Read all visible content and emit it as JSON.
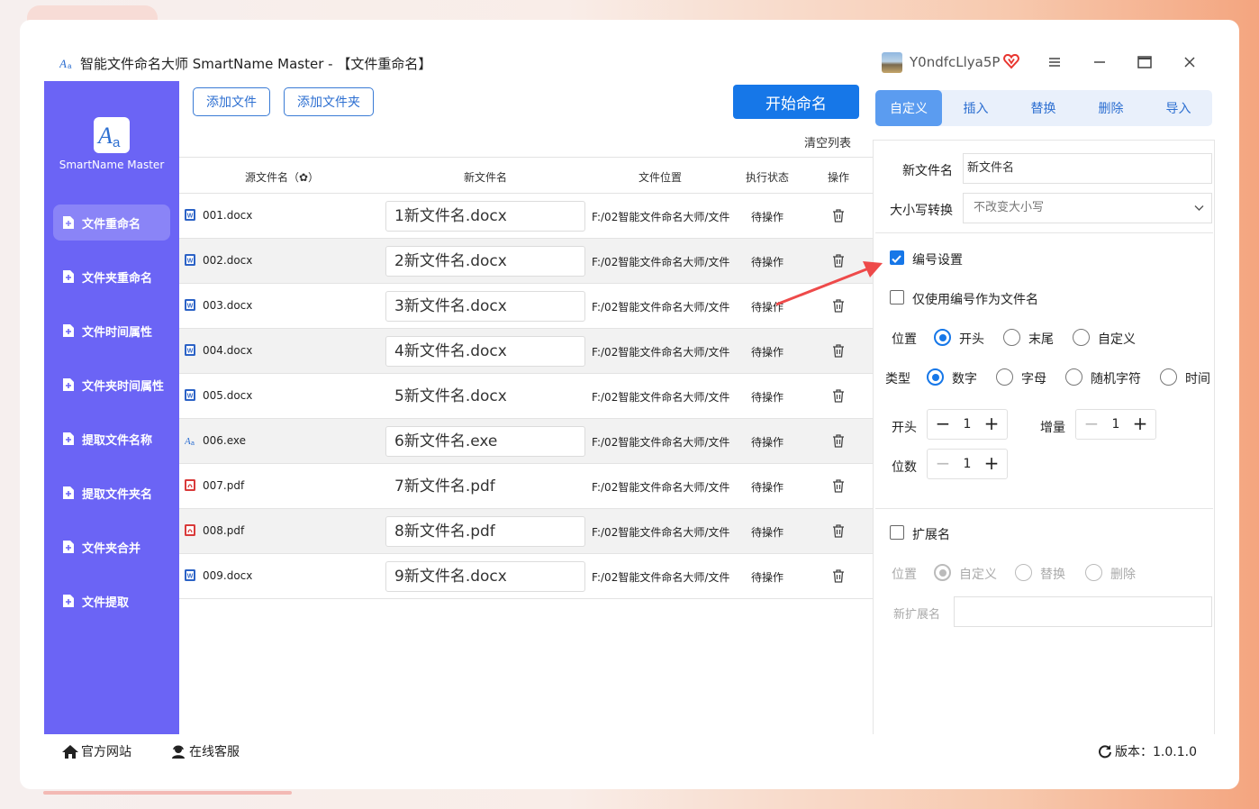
{
  "window": {
    "title": "智能文件命名大师 SmartName Master - 【文件重命名】",
    "username": "Y0ndfcLlya5P"
  },
  "sidebar": {
    "logo_text": "SmartName Master",
    "items": [
      {
        "label": "文件重命名",
        "active": true
      },
      {
        "label": "文件夹重命名",
        "active": false
      },
      {
        "label": "文件时间属性",
        "active": false
      },
      {
        "label": "文件夹时间属性",
        "active": false
      },
      {
        "label": "提取文件名称",
        "active": false
      },
      {
        "label": "提取文件夹名",
        "active": false
      },
      {
        "label": "文件夹合并",
        "active": false
      },
      {
        "label": "文件提取",
        "active": false
      }
    ]
  },
  "toolbar": {
    "add_file": "添加文件",
    "add_folder": "添加文件夹",
    "start": "开始命名",
    "clear": "清空列表"
  },
  "table": {
    "headers": {
      "source": "源文件名（✿）",
      "newname": "新文件名",
      "location": "文件位置",
      "status": "执行状态",
      "action": "操作"
    },
    "rows": [
      {
        "icon": "word-icon",
        "src": "001.docx",
        "new": "1新文件名.docx",
        "loc": "F:/02智能文件命名大师/文件",
        "status": "待操作"
      },
      {
        "icon": "word-icon",
        "src": "002.docx",
        "new": "2新文件名.docx",
        "loc": "F:/02智能文件命名大师/文件",
        "status": "待操作"
      },
      {
        "icon": "word-icon",
        "src": "003.docx",
        "new": "3新文件名.docx",
        "loc": "F:/02智能文件命名大师/文件",
        "status": "待操作"
      },
      {
        "icon": "word-icon",
        "src": "004.docx",
        "new": "4新文件名.docx",
        "loc": "F:/02智能文件命名大师/文件",
        "status": "待操作"
      },
      {
        "icon": "word-icon",
        "src": "005.docx",
        "new": "5新文件名.docx",
        "loc": "F:/02智能文件命名大师/文件",
        "status": "待操作"
      },
      {
        "icon": "app-icon",
        "src": "006.exe",
        "new": "6新文件名.exe",
        "loc": "F:/02智能文件命名大师/文件",
        "status": "待操作"
      },
      {
        "icon": "pdf-icon",
        "src": "007.pdf",
        "new": "7新文件名.pdf",
        "loc": "F:/02智能文件命名大师/文件",
        "status": "待操作"
      },
      {
        "icon": "pdf-icon",
        "src": "008.pdf",
        "new": "8新文件名.pdf",
        "loc": "F:/02智能文件命名大师/文件",
        "status": "待操作"
      },
      {
        "icon": "word-icon",
        "src": "009.docx",
        "new": "9新文件名.docx",
        "loc": "F:/02智能文件命名大师/文件",
        "status": "待操作"
      }
    ]
  },
  "right_panel": {
    "tabs": [
      "自定义",
      "插入",
      "替换",
      "删除",
      "导入"
    ],
    "active_tab": "自定义",
    "new_name_label": "新文件名",
    "new_name_value": "新文件名",
    "case_label": "大小写转换",
    "case_value": "不改变大小写",
    "numbering_label": "编号设置",
    "numbering_checked": true,
    "only_number_label": "仅使用编号作为文件名",
    "only_number_checked": false,
    "position_label": "位置",
    "position_options": [
      "开头",
      "末尾",
      "自定义"
    ],
    "position_selected": "开头",
    "type_label": "类型",
    "type_options": [
      "数字",
      "字母",
      "随机字符",
      "时间"
    ],
    "type_selected": "数字",
    "start_label": "开头",
    "start_value": "1",
    "increment_label": "增量",
    "increment_value": "1",
    "digits_label": "位数",
    "digits_value": "1",
    "ext_label": "扩展名",
    "ext_checked": false,
    "ext_position_label": "位置",
    "ext_options": [
      "自定义",
      "替换",
      "删除"
    ],
    "ext_selected": "自定义",
    "new_ext_label": "新扩展名",
    "new_ext_value": ""
  },
  "footer": {
    "website": "官方网站",
    "support": "在线客服",
    "version": "版本：1.0.1.0"
  },
  "colors": {
    "sidebar": "#6b64f5",
    "primary": "#1677e8",
    "annotation_arrow": "#ee4a4a"
  }
}
